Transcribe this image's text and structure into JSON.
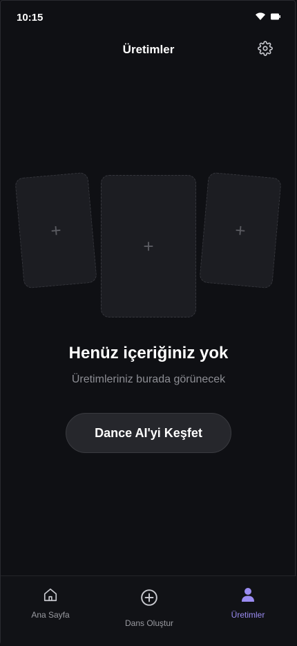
{
  "status_bar": {
    "time": "10:15"
  },
  "header": {
    "title": "Üretimler"
  },
  "cards": {
    "plus": "+"
  },
  "empty_state": {
    "title": "Henüz içeriğiniz yok",
    "subtitle": "Üretimleriniz burada görünecek",
    "cta_label": "Dance AI'yi Keşfet"
  },
  "bottom_nav": {
    "items": [
      {
        "label": "Ana Sayfa",
        "icon": "home-icon"
      },
      {
        "label": "Dans Oluştur",
        "icon": "plus-circle-icon"
      },
      {
        "label": "Üretimler",
        "icon": "user-icon",
        "active": true
      }
    ]
  },
  "colors": {
    "background": "#0f1014",
    "accent": "#9b8cf2",
    "card": "#1c1d22"
  }
}
